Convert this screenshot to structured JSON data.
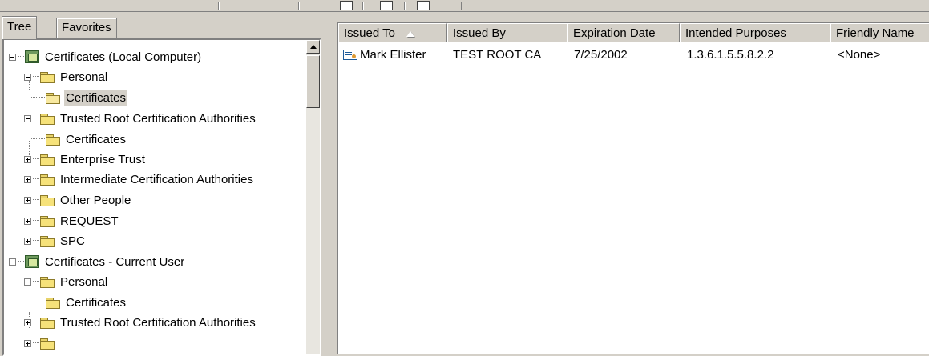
{
  "tabs": {
    "tree": "Tree",
    "favorites": "Favorites"
  },
  "tree": {
    "items": [
      {
        "label": "Certificates (Local Computer)",
        "icon": "certificate-store-icon",
        "expander": "minus"
      },
      {
        "label": "Personal",
        "icon": "folder-icon",
        "expander": "minus"
      },
      {
        "label": "Certificates",
        "icon": "open-folder-icon",
        "selected": true
      },
      {
        "label": "Trusted Root Certification Authorities",
        "icon": "folder-icon",
        "expander": "minus"
      },
      {
        "label": "Certificates",
        "icon": "folder-icon"
      },
      {
        "label": "Enterprise Trust",
        "icon": "folder-icon",
        "expander": "plus"
      },
      {
        "label": "Intermediate Certification Authorities",
        "icon": "folder-icon",
        "expander": "plus"
      },
      {
        "label": "Other People",
        "icon": "folder-icon",
        "expander": "plus"
      },
      {
        "label": "REQUEST",
        "icon": "folder-icon",
        "expander": "plus"
      },
      {
        "label": "SPC",
        "icon": "folder-icon",
        "expander": "plus"
      },
      {
        "label": "Certificates - Current User",
        "icon": "certificate-store-icon",
        "expander": "minus"
      },
      {
        "label": "Personal",
        "icon": "folder-icon",
        "expander": "minus"
      },
      {
        "label": "Certificates",
        "icon": "folder-icon"
      },
      {
        "label": "Trusted Root Certification Authorities",
        "icon": "folder-icon",
        "expander": "plus"
      }
    ]
  },
  "list": {
    "columns": [
      "Issued To",
      "Issued By",
      "Expiration Date",
      "Intended Purposes",
      "Friendly Name"
    ],
    "rows": [
      {
        "issued_to": "Mark Ellister",
        "issued_by": "TEST ROOT CA",
        "expiration": "7/25/2002",
        "purposes": "1.3.6.1.5.5.8.2.2",
        "friendly_name": "<None>"
      }
    ]
  }
}
